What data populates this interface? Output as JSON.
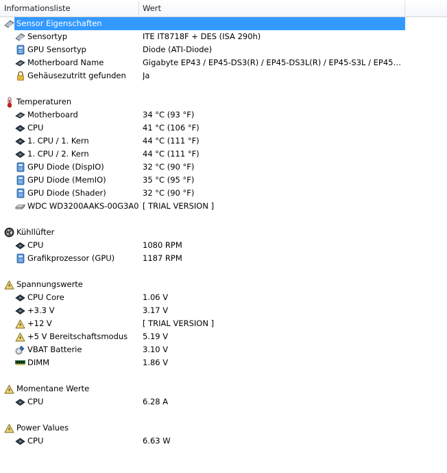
{
  "header": {
    "col1": "Informationsliste",
    "col2": "Wert"
  },
  "groups": [
    {
      "title": "Sensor Eigenschaften",
      "icon": "sensor-icon",
      "selected": true,
      "items": [
        {
          "label": "Sensortyp",
          "value": "ITE IT8718F + DES  (ISA 290h)",
          "icon": "sensor-icon"
        },
        {
          "label": "GPU Sensortyp",
          "value": "Diode  (ATI-Diode)",
          "icon": "gpu-icon"
        },
        {
          "label": "Motherboard Name",
          "value": "Gigabyte EP43 / EP45-DS3(R) / EP45-DS3L(R) / EP45-S3L / EP45C / EP4...",
          "icon": "motherboard-icon"
        },
        {
          "label": "Gehäusezutritt gefunden",
          "value": "Ja",
          "icon": "lock-icon"
        }
      ]
    },
    {
      "title": "Temperaturen",
      "icon": "thermometer-icon",
      "items": [
        {
          "label": "Motherboard",
          "value": "34 °C  (93 °F)",
          "icon": "motherboard-icon"
        },
        {
          "label": "CPU",
          "value": "41 °C  (106 °F)",
          "icon": "cpu-icon"
        },
        {
          "label": "1. CPU / 1. Kern",
          "value": "44 °C  (111 °F)",
          "icon": "cpu-icon"
        },
        {
          "label": "1. CPU / 2. Kern",
          "value": "44 °C  (111 °F)",
          "icon": "cpu-icon"
        },
        {
          "label": "GPU Diode (DispIO)",
          "value": "32 °C  (90 °F)",
          "icon": "gpu-icon"
        },
        {
          "label": "GPU Diode (MemIO)",
          "value": "35 °C  (95 °F)",
          "icon": "gpu-icon"
        },
        {
          "label": "GPU Diode (Shader)",
          "value": "32 °C  (90 °F)",
          "icon": "gpu-icon"
        },
        {
          "label": "WDC WD3200AAKS-00G3A0",
          "value": "[ TRIAL VERSION ]",
          "icon": "harddisk-icon"
        }
      ]
    },
    {
      "title": "Kühllüfter",
      "icon": "fan-icon",
      "items": [
        {
          "label": "CPU",
          "value": "1080 RPM",
          "icon": "cpu-icon"
        },
        {
          "label": "Grafikprozessor (GPU)",
          "value": "1187 RPM",
          "icon": "gpu-icon"
        }
      ]
    },
    {
      "title": "Spannungswerte",
      "icon": "voltage-icon",
      "items": [
        {
          "label": "CPU Core",
          "value": "1.06 V",
          "icon": "cpu-icon"
        },
        {
          "label": "+3.3 V",
          "value": "3.17 V",
          "icon": "cpu-icon"
        },
        {
          "label": "+12 V",
          "value": "[ TRIAL VERSION ]",
          "icon": "voltage-icon"
        },
        {
          "label": "+5 V Bereitschaftsmodus",
          "value": "5.19 V",
          "icon": "voltage-icon"
        },
        {
          "label": "VBAT Batterie",
          "value": "3.10 V",
          "icon": "battery-icon"
        },
        {
          "label": "DIMM",
          "value": "1.86 V",
          "icon": "memory-icon"
        }
      ]
    },
    {
      "title": "Momentane Werte",
      "icon": "voltage-icon",
      "items": [
        {
          "label": "CPU",
          "value": "6.28 A",
          "icon": "cpu-icon"
        }
      ]
    },
    {
      "title": "Power Values",
      "icon": "voltage-icon",
      "items": [
        {
          "label": "CPU",
          "value": "6.63 W",
          "icon": "cpu-icon"
        }
      ]
    }
  ]
}
